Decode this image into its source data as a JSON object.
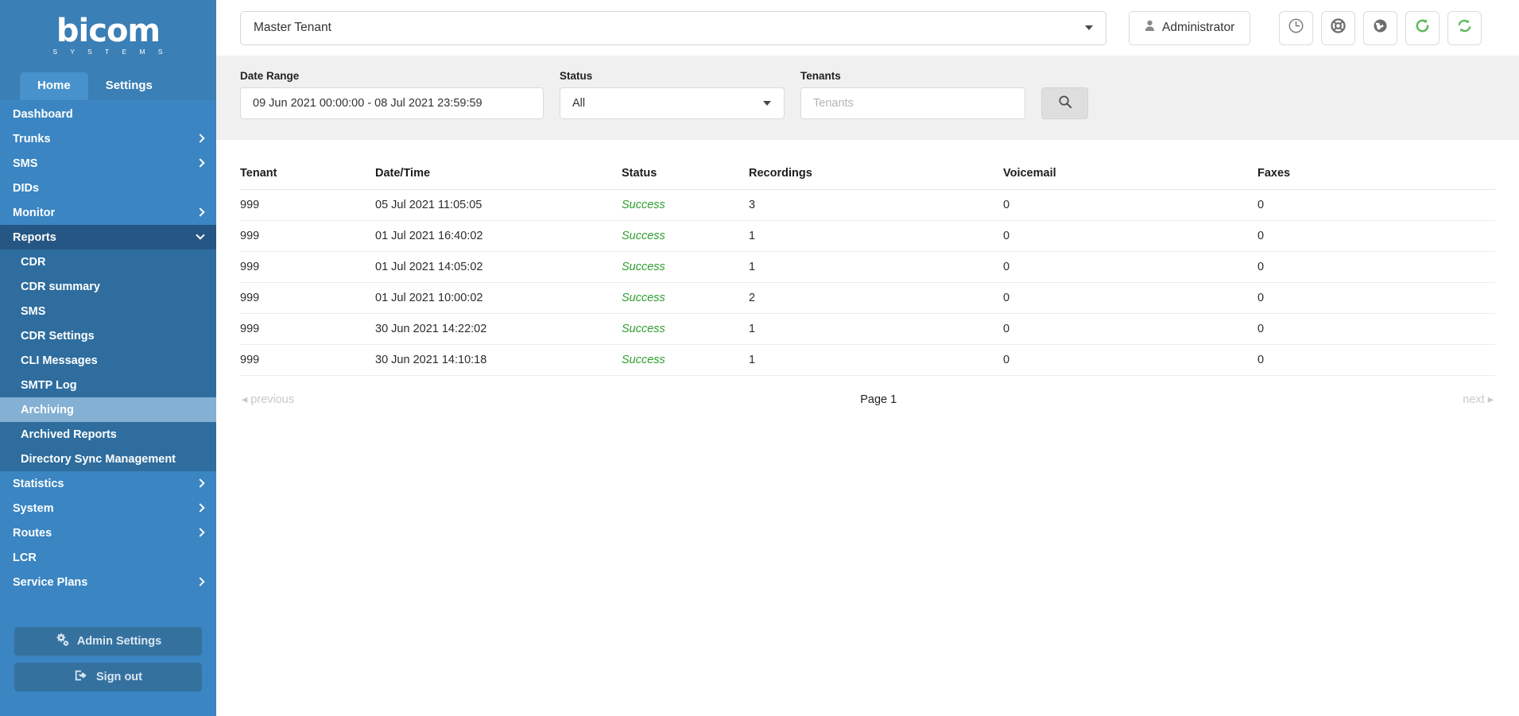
{
  "sidebar": {
    "logo": {
      "word": "bicom",
      "sub": "S Y S T E M S"
    },
    "tabs": [
      {
        "label": "Home",
        "active": true
      },
      {
        "label": "Settings",
        "active": false
      }
    ],
    "nav": [
      {
        "label": "Dashboard",
        "chevron": "none"
      },
      {
        "label": "Trunks",
        "chevron": "right"
      },
      {
        "label": "SMS",
        "chevron": "right"
      },
      {
        "label": "DIDs",
        "chevron": "none"
      },
      {
        "label": "Monitor",
        "chevron": "right"
      },
      {
        "label": "Reports",
        "chevron": "down"
      }
    ],
    "sub_items": [
      {
        "label": "CDR",
        "active": false
      },
      {
        "label": "CDR summary",
        "active": false
      },
      {
        "label": "SMS",
        "active": false
      },
      {
        "label": "CDR Settings",
        "active": false
      },
      {
        "label": "CLI Messages",
        "active": false
      },
      {
        "label": "SMTP Log",
        "active": false
      },
      {
        "label": "Archiving",
        "active": true
      },
      {
        "label": "Archived Reports",
        "active": false
      },
      {
        "label": "Directory Sync Management",
        "active": false
      }
    ],
    "nav_after": [
      {
        "label": "Statistics",
        "chevron": "right"
      },
      {
        "label": "System",
        "chevron": "right"
      },
      {
        "label": "Routes",
        "chevron": "right"
      },
      {
        "label": "LCR",
        "chevron": "none"
      },
      {
        "label": "Service Plans",
        "chevron": "right"
      }
    ],
    "footer": {
      "admin_settings": "Admin Settings",
      "sign_out": "Sign out"
    }
  },
  "topbar": {
    "tenant_value": "Master Tenant",
    "admin_label": "Administrator",
    "icons": [
      "clock-icon",
      "life-ring-icon",
      "globe-icon",
      "refresh-icon",
      "sync-icon"
    ]
  },
  "filters": {
    "date_range_label": "Date Range",
    "date_range_value": "09 Jun 2021 00:00:00 - 08 Jul 2021 23:59:59",
    "status_label": "Status",
    "status_value": "All",
    "tenants_label": "Tenants",
    "tenants_placeholder": "Tenants",
    "tenants_value": "",
    "search_icon": "search-icon"
  },
  "table": {
    "columns": [
      "Tenant",
      "Date/Time",
      "Status",
      "Recordings",
      "Voicemail",
      "Faxes"
    ],
    "rows": [
      {
        "tenant": "999",
        "datetime": "05 Jul 2021 11:05:05",
        "status": "Success",
        "recordings": "3",
        "voicemail": "0",
        "faxes": "0"
      },
      {
        "tenant": "999",
        "datetime": "01 Jul 2021 16:40:02",
        "status": "Success",
        "recordings": "1",
        "voicemail": "0",
        "faxes": "0"
      },
      {
        "tenant": "999",
        "datetime": "01 Jul 2021 14:05:02",
        "status": "Success",
        "recordings": "1",
        "voicemail": "0",
        "faxes": "0"
      },
      {
        "tenant": "999",
        "datetime": "01 Jul 2021 10:00:02",
        "status": "Success",
        "recordings": "2",
        "voicemail": "0",
        "faxes": "0"
      },
      {
        "tenant": "999",
        "datetime": "30 Jun 2021 14:22:02",
        "status": "Success",
        "recordings": "1",
        "voicemail": "0",
        "faxes": "0"
      },
      {
        "tenant": "999",
        "datetime": "30 Jun 2021 14:10:18",
        "status": "Success",
        "recordings": "1",
        "voicemail": "0",
        "faxes": "0"
      }
    ]
  },
  "pagination": {
    "previous": "previous",
    "page": "Page 1",
    "next": "next"
  },
  "colors": {
    "sidebar": "#3a85c2",
    "sidebar_dark": "#255684",
    "sidebar_sub": "#2e6d9e",
    "sidebar_active": "#84b0d4",
    "success": "#2e9e2e",
    "accent_green": "#5cb85c",
    "filter_bg": "#f0f0f0"
  }
}
